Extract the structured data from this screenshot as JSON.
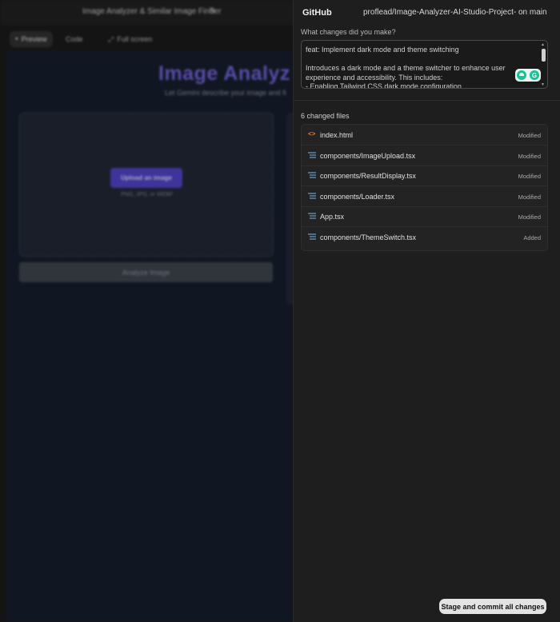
{
  "background_app": {
    "title": "Image Analyzer & Similar Image Finder",
    "tabs": [
      "Preview",
      "Code",
      "Full screen"
    ],
    "heading": "Image Analyz",
    "subheading": "Let Gemini describe your image and fi",
    "upload_button": "Upload an image",
    "formats": "PNG, JPG, or WEBP",
    "analyze_button": "Analyze Image"
  },
  "modal": {
    "title": "GitHub",
    "repo": "proflead/Image-Analyzer-AI-Studio-Project- on main",
    "message_label": "What changes did you make?",
    "commit_message": "feat: Implement dark mode and theme switching\n\nIntroduces a dark mode and a theme switcher to enhance user experience and accessibility. This includes:\n- Enabling Tailwind CSS dark mode configuration",
    "changed_files_heading": "6 changed files",
    "files": [
      {
        "name": "index.html",
        "status": "Modified",
        "icon": "code-icon"
      },
      {
        "name": "components/ImageUpload.tsx",
        "status": "Modified",
        "icon": "file-lines-icon"
      },
      {
        "name": "components/ResultDisplay.tsx",
        "status": "Modified",
        "icon": "file-lines-icon"
      },
      {
        "name": "components/Loader.tsx",
        "status": "Modified",
        "icon": "file-lines-icon"
      },
      {
        "name": "App.tsx",
        "status": "Modified",
        "icon": "file-lines-icon"
      },
      {
        "name": "components/ThemeSwitch.tsx",
        "status": "Added",
        "icon": "file-lines-icon"
      }
    ],
    "commit_button": "Stage and commit all changes"
  },
  "colors": {
    "accent": "#6d5fd8",
    "modal_bg": "#1e1e1e",
    "code_icon": "#e0813b"
  }
}
